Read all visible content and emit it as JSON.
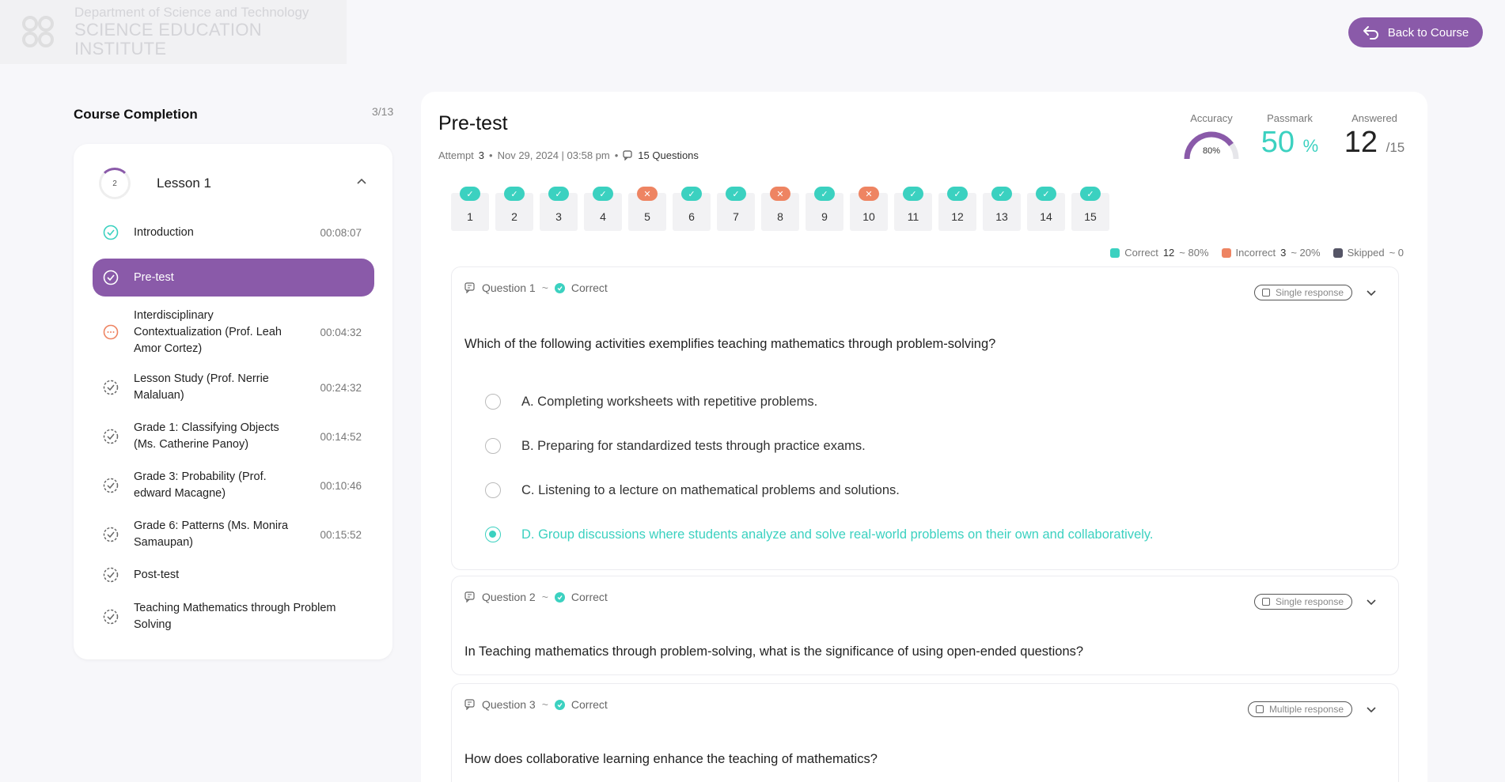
{
  "header": {
    "org_line1": "Department of Science and Technology",
    "org_line2": "SCIENCE EDUCATION INSTITUTE",
    "back_label": "Back to Course",
    "back_icon": "return-arrow-icon"
  },
  "sidebar": {
    "title": "Course Completion",
    "count": "3/13",
    "lesson": {
      "progress": "2",
      "name": "Lesson 1"
    },
    "items": [
      {
        "label": "Introduction",
        "duration": "00:08:07",
        "status": "complete",
        "icon": "check-circle-icon"
      },
      {
        "label": "Pre-test",
        "duration": "",
        "status": "active",
        "icon": "check-circle-icon"
      },
      {
        "label": "Interdisciplinary Contextualization (Prof. Leah Amor Cortez)",
        "duration": "00:04:32",
        "status": "in-progress",
        "icon": "ellipsis-circle-icon"
      },
      {
        "label": "Lesson Study (Prof. Nerrie Malaluan)",
        "duration": "00:24:32",
        "status": "pending",
        "icon": "dashed-check-circle-icon"
      },
      {
        "label": "Grade 1: Classifying Objects (Ms. Catherine Panoy)",
        "duration": "00:14:52",
        "status": "pending",
        "icon": "dashed-check-circle-icon"
      },
      {
        "label": "Grade 3: Probability (Prof. edward Macagne)",
        "duration": "00:10:46",
        "status": "pending",
        "icon": "dashed-check-circle-icon"
      },
      {
        "label": "Grade 6: Patterns (Ms. Monira Samaupan)",
        "duration": "00:15:52",
        "status": "pending",
        "icon": "dashed-check-circle-icon"
      },
      {
        "label": "Post-test",
        "duration": "",
        "status": "pending",
        "icon": "dashed-check-circle-icon"
      },
      {
        "label": "Teaching Mathematics through Problem Solving",
        "duration": "",
        "status": "pending",
        "icon": "dashed-check-circle-icon"
      }
    ]
  },
  "main": {
    "title": "Pre-test",
    "meta": {
      "attempt_label": "Attempt",
      "attempt": "3",
      "date": "Nov 29, 2024 | 03:58 pm",
      "questions": "15 Questions"
    },
    "stats": {
      "accuracy_label": "Accuracy",
      "accuracy_value": "80%",
      "accuracy_fraction": 0.8,
      "passmark_label": "Passmark",
      "passmark_value": "50",
      "passmark_unit": "%",
      "answered_label": "Answered",
      "answered_value": "12",
      "answered_total": "/15"
    },
    "question_nav": [
      {
        "n": "1",
        "status": "correct"
      },
      {
        "n": "2",
        "status": "correct"
      },
      {
        "n": "3",
        "status": "correct"
      },
      {
        "n": "4",
        "status": "correct"
      },
      {
        "n": "5",
        "status": "incorrect"
      },
      {
        "n": "6",
        "status": "correct"
      },
      {
        "n": "7",
        "status": "correct"
      },
      {
        "n": "8",
        "status": "incorrect"
      },
      {
        "n": "9",
        "status": "correct"
      },
      {
        "n": "10",
        "status": "incorrect"
      },
      {
        "n": "11",
        "status": "correct"
      },
      {
        "n": "12",
        "status": "correct"
      },
      {
        "n": "13",
        "status": "correct"
      },
      {
        "n": "14",
        "status": "correct"
      },
      {
        "n": "15",
        "status": "correct"
      }
    ],
    "legend": {
      "correct_label": "Correct",
      "correct_count": "12",
      "correct_pct": "~ 80%",
      "incorrect_label": "Incorrect",
      "incorrect_count": "3",
      "incorrect_pct": "~ 20%",
      "skipped_label": "Skipped",
      "skipped_count": "~ 0"
    },
    "questions": [
      {
        "title": "Question 1",
        "result": "Correct",
        "type": "Single response",
        "text": "Which of the following activities exemplifies teaching mathematics through problem-solving?",
        "options": [
          "A. Completing worksheets with repetitive problems.",
          "B. Preparing for standardized tests through practice exams.",
          "C. Listening to a lecture on mathematical problems and solutions.",
          "D. Group discussions where students analyze and solve real-world problems on their own and collaboratively."
        ]
      },
      {
        "title": "Question 2",
        "result": "Correct",
        "type": "Single response",
        "text": "In Teaching mathematics through problem-solving, what is the significance of using open-ended questions?"
      },
      {
        "title": "Question 3",
        "result": "Correct",
        "type": "Multiple response",
        "text": "How does collaborative learning enhance the teaching of mathematics?"
      }
    ]
  },
  "colors": {
    "accent": "#8a5aa9",
    "correct": "#3bd1c0",
    "incorrect": "#ee8462",
    "skipped": "#555566"
  }
}
